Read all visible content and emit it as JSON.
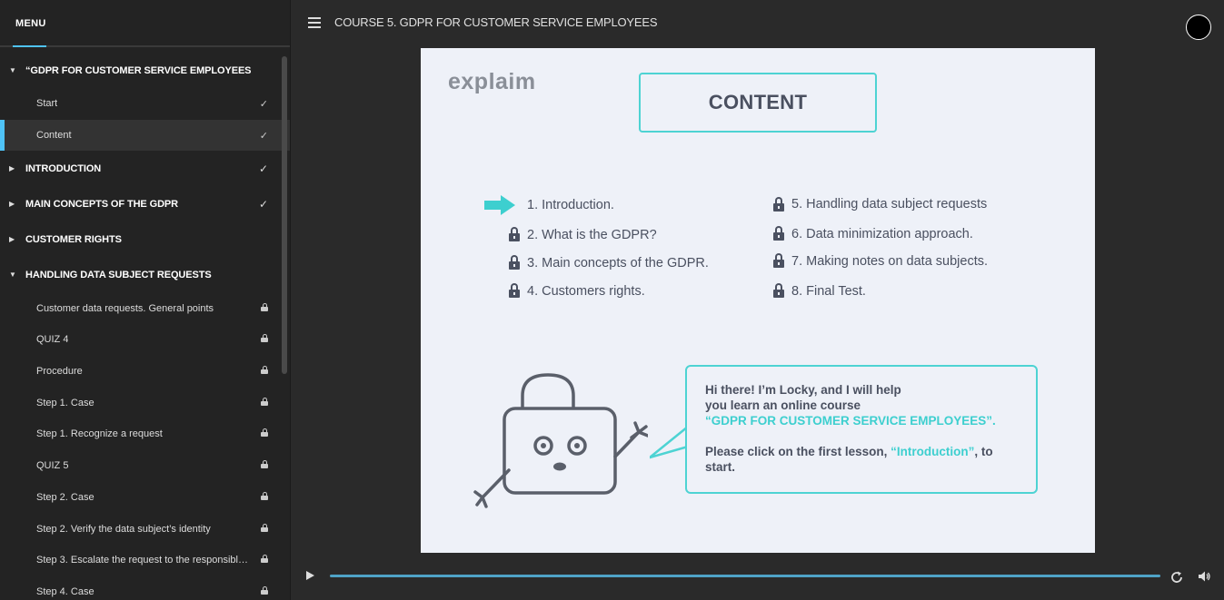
{
  "sidebar": {
    "menu_label": "MENU",
    "sections": [
      {
        "title": "“GDPR FOR CUSTOMER SERVICE EMPLOYEES",
        "expanded": true,
        "status": "",
        "lessons": [
          {
            "label": "Start",
            "status": "check"
          },
          {
            "label": "Content",
            "status": "check",
            "active": true
          }
        ]
      },
      {
        "title": "INTRODUCTION",
        "expanded": false,
        "status": "check",
        "lessons": []
      },
      {
        "title": "MAIN CONCEPTS OF THE GDPR",
        "expanded": false,
        "status": "check",
        "lessons": []
      },
      {
        "title": "CUSTOMER RIGHTS",
        "expanded": false,
        "status": "",
        "lessons": []
      },
      {
        "title": "HANDLING DATA SUBJECT REQUESTS",
        "expanded": true,
        "status": "",
        "lessons": [
          {
            "label": "Customer data requests. General points",
            "status": "lock"
          },
          {
            "label": "QUIZ 4",
            "status": "lock"
          },
          {
            "label": "Procedure",
            "status": "lock"
          },
          {
            "label": "Step 1. Case",
            "status": "lock"
          },
          {
            "label": "Step 1. Recognize a request",
            "status": "lock"
          },
          {
            "label": "QUIZ 5",
            "status": "lock"
          },
          {
            "label": "Step 2. Case",
            "status": "lock"
          },
          {
            "label": "Step 2. Verify the data subject’s identity",
            "status": "lock"
          },
          {
            "label": "Step 3. Escalate the request to the responsible ...",
            "status": "lock"
          },
          {
            "label": "Step 4. Case",
            "status": "lock"
          }
        ]
      }
    ]
  },
  "topbar": {
    "course_title": "COURSE 5. GDPR FOR CUSTOMER SERVICE EMPLOYEES"
  },
  "slide": {
    "logo": "explaim",
    "heading": "CONTENT",
    "toc_left": [
      {
        "label": "1. Introduction.",
        "state": "current"
      },
      {
        "label": "2. What is the GDPR?",
        "state": "locked"
      },
      {
        "label": "3. Main concepts of the GDPR.",
        "state": "locked"
      },
      {
        "label": "4. Customers rights.",
        "state": "locked"
      }
    ],
    "toc_right": [
      {
        "label": "5. Handling data subject requests",
        "state": "locked"
      },
      {
        "label": "6. Data minimization approach.",
        "state": "locked"
      },
      {
        "label": "7. Making notes on data subjects.",
        "state": "locked"
      },
      {
        "label": "8. Final Test.",
        "state": "locked"
      }
    ],
    "bubble": {
      "line1": "Hi there! I’m Locky, and I will help",
      "line2": "you learn an online course",
      "course": "“GDPR FOR CUSTOMER SERVICE EMPLOYEES”.",
      "cta_before": "Please click on the first lesson, ",
      "cta_link": "“Introduction”",
      "cta_after": ", to start."
    }
  },
  "player": {
    "progress_fraction": 1.0
  },
  "colors": {
    "accent_blue": "#4fc3f7",
    "accent_teal": "#4dd3d3",
    "slide_bg": "#eef1f8",
    "text_dark": "#4a5060"
  }
}
